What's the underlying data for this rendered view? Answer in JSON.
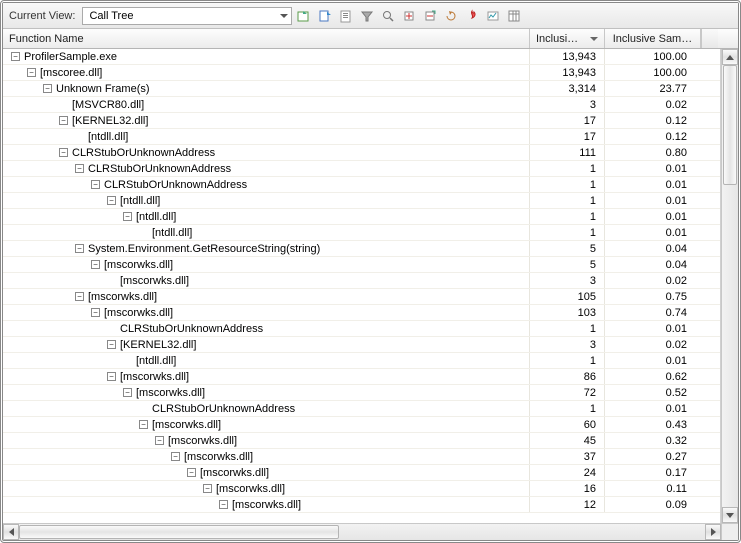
{
  "toolbar": {
    "label": "Current View:",
    "dropdown_value": "Call Tree",
    "icons": [
      "import-icon",
      "export-icon",
      "report-icon",
      "filter-icon",
      "search-icon",
      "expand-icon",
      "collapse-icon",
      "refresh-icon",
      "hotpath-icon",
      "reduce-noise-icon",
      "columns-icon"
    ]
  },
  "columns": {
    "name": "Function Name",
    "incl": "Inclusi…",
    "pct": "Inclusive Sam…"
  },
  "rows": [
    {
      "depth": 0,
      "toggle": "-",
      "name": "ProfilerSample.exe",
      "incl": "13,943",
      "pct": "100.00"
    },
    {
      "depth": 1,
      "toggle": "-",
      "name": "[mscoree.dll]",
      "incl": "13,943",
      "pct": "100.00"
    },
    {
      "depth": 2,
      "toggle": "-",
      "name": "Unknown Frame(s)",
      "incl": "3,314",
      "pct": "23.77"
    },
    {
      "depth": 3,
      "toggle": "",
      "name": "[MSVCR80.dll]",
      "incl": "3",
      "pct": "0.02"
    },
    {
      "depth": 3,
      "toggle": "-",
      "name": "[KERNEL32.dll]",
      "incl": "17",
      "pct": "0.12"
    },
    {
      "depth": 4,
      "toggle": "",
      "name": "[ntdll.dll]",
      "incl": "17",
      "pct": "0.12"
    },
    {
      "depth": 3,
      "toggle": "-",
      "name": "CLRStubOrUnknownAddress",
      "incl": "111",
      "pct": "0.80"
    },
    {
      "depth": 4,
      "toggle": "-",
      "name": "CLRStubOrUnknownAddress",
      "incl": "1",
      "pct": "0.01"
    },
    {
      "depth": 5,
      "toggle": "-",
      "name": "CLRStubOrUnknownAddress",
      "incl": "1",
      "pct": "0.01"
    },
    {
      "depth": 6,
      "toggle": "-",
      "name": "[ntdll.dll]",
      "incl": "1",
      "pct": "0.01"
    },
    {
      "depth": 7,
      "toggle": "-",
      "name": "[ntdll.dll]",
      "incl": "1",
      "pct": "0.01"
    },
    {
      "depth": 8,
      "toggle": "",
      "name": "[ntdll.dll]",
      "incl": "1",
      "pct": "0.01"
    },
    {
      "depth": 4,
      "toggle": "-",
      "name": "System.Environment.GetResourceString(string)",
      "incl": "5",
      "pct": "0.04"
    },
    {
      "depth": 5,
      "toggle": "-",
      "name": "[mscorwks.dll]",
      "incl": "5",
      "pct": "0.04"
    },
    {
      "depth": 6,
      "toggle": "",
      "name": "[mscorwks.dll]",
      "incl": "3",
      "pct": "0.02"
    },
    {
      "depth": 4,
      "toggle": "-",
      "name": "[mscorwks.dll]",
      "incl": "105",
      "pct": "0.75"
    },
    {
      "depth": 5,
      "toggle": "-",
      "name": "[mscorwks.dll]",
      "incl": "103",
      "pct": "0.74"
    },
    {
      "depth": 6,
      "toggle": "",
      "name": "CLRStubOrUnknownAddress",
      "incl": "1",
      "pct": "0.01"
    },
    {
      "depth": 6,
      "toggle": "-",
      "name": "[KERNEL32.dll]",
      "incl": "3",
      "pct": "0.02"
    },
    {
      "depth": 7,
      "toggle": "",
      "name": "[ntdll.dll]",
      "incl": "1",
      "pct": "0.01"
    },
    {
      "depth": 6,
      "toggle": "-",
      "name": "[mscorwks.dll]",
      "incl": "86",
      "pct": "0.62"
    },
    {
      "depth": 7,
      "toggle": "-",
      "name": "[mscorwks.dll]",
      "incl": "72",
      "pct": "0.52"
    },
    {
      "depth": 8,
      "toggle": "",
      "name": "CLRStubOrUnknownAddress",
      "incl": "1",
      "pct": "0.01"
    },
    {
      "depth": 8,
      "toggle": "-",
      "name": "[mscorwks.dll]",
      "incl": "60",
      "pct": "0.43"
    },
    {
      "depth": 9,
      "toggle": "-",
      "name": "[mscorwks.dll]",
      "incl": "45",
      "pct": "0.32"
    },
    {
      "depth": 10,
      "toggle": "-",
      "name": "[mscorwks.dll]",
      "incl": "37",
      "pct": "0.27"
    },
    {
      "depth": 11,
      "toggle": "-",
      "name": "[mscorwks.dll]",
      "incl": "24",
      "pct": "0.17"
    },
    {
      "depth": 12,
      "toggle": "-",
      "name": "[mscorwks.dll]",
      "incl": "16",
      "pct": "0.11"
    },
    {
      "depth": 13,
      "toggle": "-",
      "name": "[mscorwks.dll]",
      "incl": "12",
      "pct": "0.09"
    }
  ]
}
